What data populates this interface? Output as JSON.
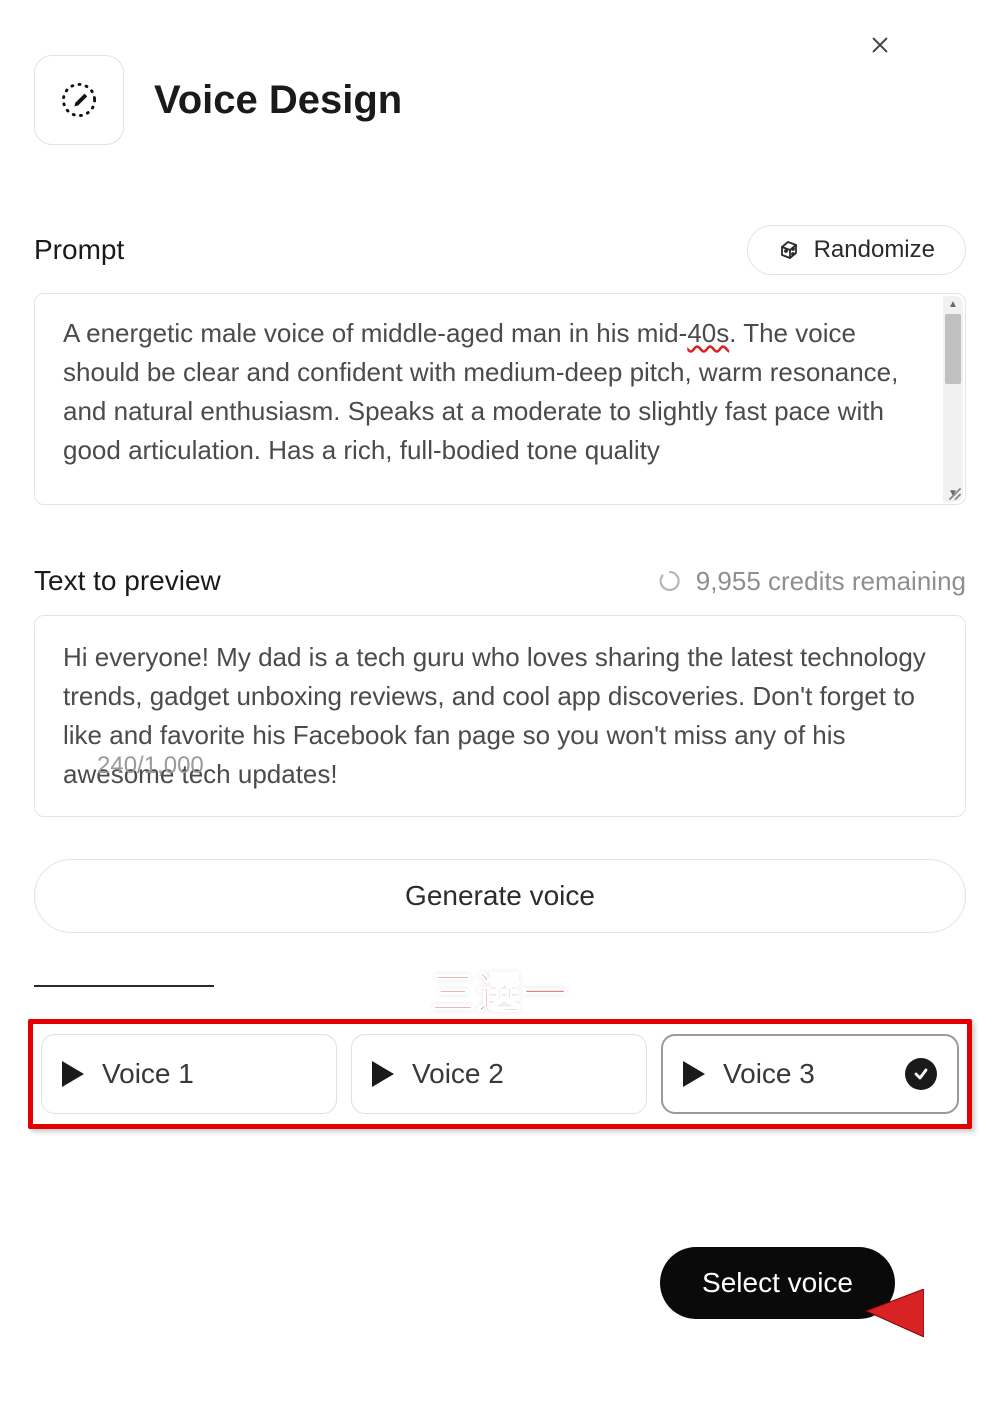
{
  "header": {
    "title": "Voice Design"
  },
  "prompt": {
    "label": "Prompt",
    "randomize_label": "Randomize",
    "text_prefix": "A energetic male voice of middle-aged man in his mid-",
    "text_err": "40s",
    "text_suffix": ". The voice should be clear and confident with medium-deep pitch, warm resonance, and natural enthusiasm. Speaks at a moderate to slightly fast pace with good articulation. Has a rich, full-bodied tone quality"
  },
  "preview": {
    "label": "Text to preview",
    "credits": "9,955 credits remaining",
    "text": "Hi everyone! My dad is a tech guru who loves sharing the latest technology trends, gadget unboxing reviews, and cool app discoveries. Don't forget to like and favorite his Facebook fan page so you won't miss any of his awesome tech updates!",
    "char_count": "240/1,000"
  },
  "generate_label": "Generate voice",
  "annotation": "三選一",
  "voices": [
    {
      "label": "Voice 1",
      "selected": false
    },
    {
      "label": "Voice 2",
      "selected": false
    },
    {
      "label": "Voice 3",
      "selected": true
    }
  ],
  "select_label": "Select voice"
}
